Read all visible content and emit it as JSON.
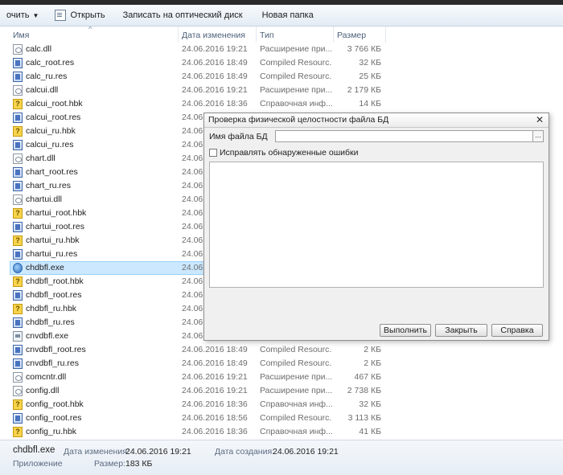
{
  "toolbar": {
    "organize": "очить",
    "open": "Открыть",
    "burn": "Записать на оптический диск",
    "new_folder": "Новая папка"
  },
  "columns": {
    "name": "Имя",
    "date": "Дата изменения",
    "type": "Тип",
    "size": "Размер"
  },
  "files": [
    {
      "name": "calc.dll",
      "date": "24.06.2016 19:21",
      "type": "Расширение при...",
      "size": "3 766 КБ",
      "icon": "dll"
    },
    {
      "name": "calc_root.res",
      "date": "24.06.2016 18:49",
      "type": "Compiled Resourc...",
      "size": "32 КБ",
      "icon": "res"
    },
    {
      "name": "calc_ru.res",
      "date": "24.06.2016 18:49",
      "type": "Compiled Resourc...",
      "size": "25 КБ",
      "icon": "res"
    },
    {
      "name": "calcui.dll",
      "date": "24.06.2016 19:21",
      "type": "Расширение при...",
      "size": "2 179 КБ",
      "icon": "dll"
    },
    {
      "name": "calcui_root.hbk",
      "date": "24.06.2016 18:36",
      "type": "Справочная инф...",
      "size": "14 КБ",
      "icon": "hbk"
    },
    {
      "name": "calcui_root.res",
      "date": "24.06.",
      "type": "",
      "size": "",
      "icon": "res"
    },
    {
      "name": "calcui_ru.hbk",
      "date": "24.06.",
      "type": "",
      "size": "",
      "icon": "hbk"
    },
    {
      "name": "calcui_ru.res",
      "date": "24.06.",
      "type": "",
      "size": "",
      "icon": "res"
    },
    {
      "name": "chart.dll",
      "date": "24.06.",
      "type": "",
      "size": "",
      "icon": "dll"
    },
    {
      "name": "chart_root.res",
      "date": "24.06.",
      "type": "",
      "size": "",
      "icon": "res"
    },
    {
      "name": "chart_ru.res",
      "date": "24.06.",
      "type": "",
      "size": "",
      "icon": "res"
    },
    {
      "name": "chartui.dll",
      "date": "24.06.",
      "type": "",
      "size": "",
      "icon": "dll"
    },
    {
      "name": "chartui_root.hbk",
      "date": "24.06.",
      "type": "",
      "size": "",
      "icon": "hbk"
    },
    {
      "name": "chartui_root.res",
      "date": "24.06.",
      "type": "",
      "size": "",
      "icon": "res"
    },
    {
      "name": "chartui_ru.hbk",
      "date": "24.06.",
      "type": "",
      "size": "",
      "icon": "hbk"
    },
    {
      "name": "chartui_ru.res",
      "date": "24.06.",
      "type": "",
      "size": "",
      "icon": "res"
    },
    {
      "name": "chdbfl.exe",
      "date": "24.06.",
      "type": "",
      "size": "",
      "icon": "exe1c",
      "selected": true
    },
    {
      "name": "chdbfl_root.hbk",
      "date": "24.06.",
      "type": "",
      "size": "",
      "icon": "hbk"
    },
    {
      "name": "chdbfl_root.res",
      "date": "24.06.",
      "type": "",
      "size": "",
      "icon": "res"
    },
    {
      "name": "chdbfl_ru.hbk",
      "date": "24.06.",
      "type": "",
      "size": "",
      "icon": "hbk"
    },
    {
      "name": "chdbfl_ru.res",
      "date": "24.06.",
      "type": "",
      "size": "",
      "icon": "res"
    },
    {
      "name": "cnvdbfl.exe",
      "date": "24.06.",
      "type": "",
      "size": "",
      "icon": "exe"
    },
    {
      "name": "cnvdbfl_root.res",
      "date": "24.06.2016 18:49",
      "type": "Compiled Resourc...",
      "size": "2 КБ",
      "icon": "res"
    },
    {
      "name": "cnvdbfl_ru.res",
      "date": "24.06.2016 18:49",
      "type": "Compiled Resourc...",
      "size": "2 КБ",
      "icon": "res"
    },
    {
      "name": "comcntr.dll",
      "date": "24.06.2016 19:21",
      "type": "Расширение при...",
      "size": "467 КБ",
      "icon": "dll"
    },
    {
      "name": "config.dll",
      "date": "24.06.2016 19:21",
      "type": "Расширение при...",
      "size": "2 738 КБ",
      "icon": "dll"
    },
    {
      "name": "config_root.hbk",
      "date": "24.06.2016 18:36",
      "type": "Справочная инф...",
      "size": "32 КБ",
      "icon": "hbk"
    },
    {
      "name": "config_root.res",
      "date": "24.06.2016 18:56",
      "type": "Compiled Resourc...",
      "size": "3 113 КБ",
      "icon": "res"
    },
    {
      "name": "config_ru.hbk",
      "date": "24.06.2016 18:36",
      "type": "Справочная инф...",
      "size": "41 КБ",
      "icon": "hbk"
    }
  ],
  "dialog": {
    "title": "Проверка физической целостности файла БД",
    "close_glyph": "✕",
    "db_file_label": "Имя файла БД",
    "db_file_value": "",
    "browse_label": "...",
    "fix_errors_label": "Исправлять обнаруженные ошибки",
    "fix_errors_checked": false,
    "run_label": "Выполнить",
    "close_label": "Закрыть",
    "help_label": "Справка"
  },
  "details": {
    "filename": "chdbfl.exe",
    "type": "Приложение",
    "modified_label": "Дата изменения:",
    "modified_value": "24.06.2016 19:21",
    "created_label": "Дата создания:",
    "created_value": "24.06.2016 19:21",
    "size_label": "Размер:",
    "size_value": "183 КБ"
  },
  "colors": {
    "selection": "#cce8ff",
    "selection_border": "#99d1ff",
    "toolbar_bg": "#e3ebf4"
  }
}
